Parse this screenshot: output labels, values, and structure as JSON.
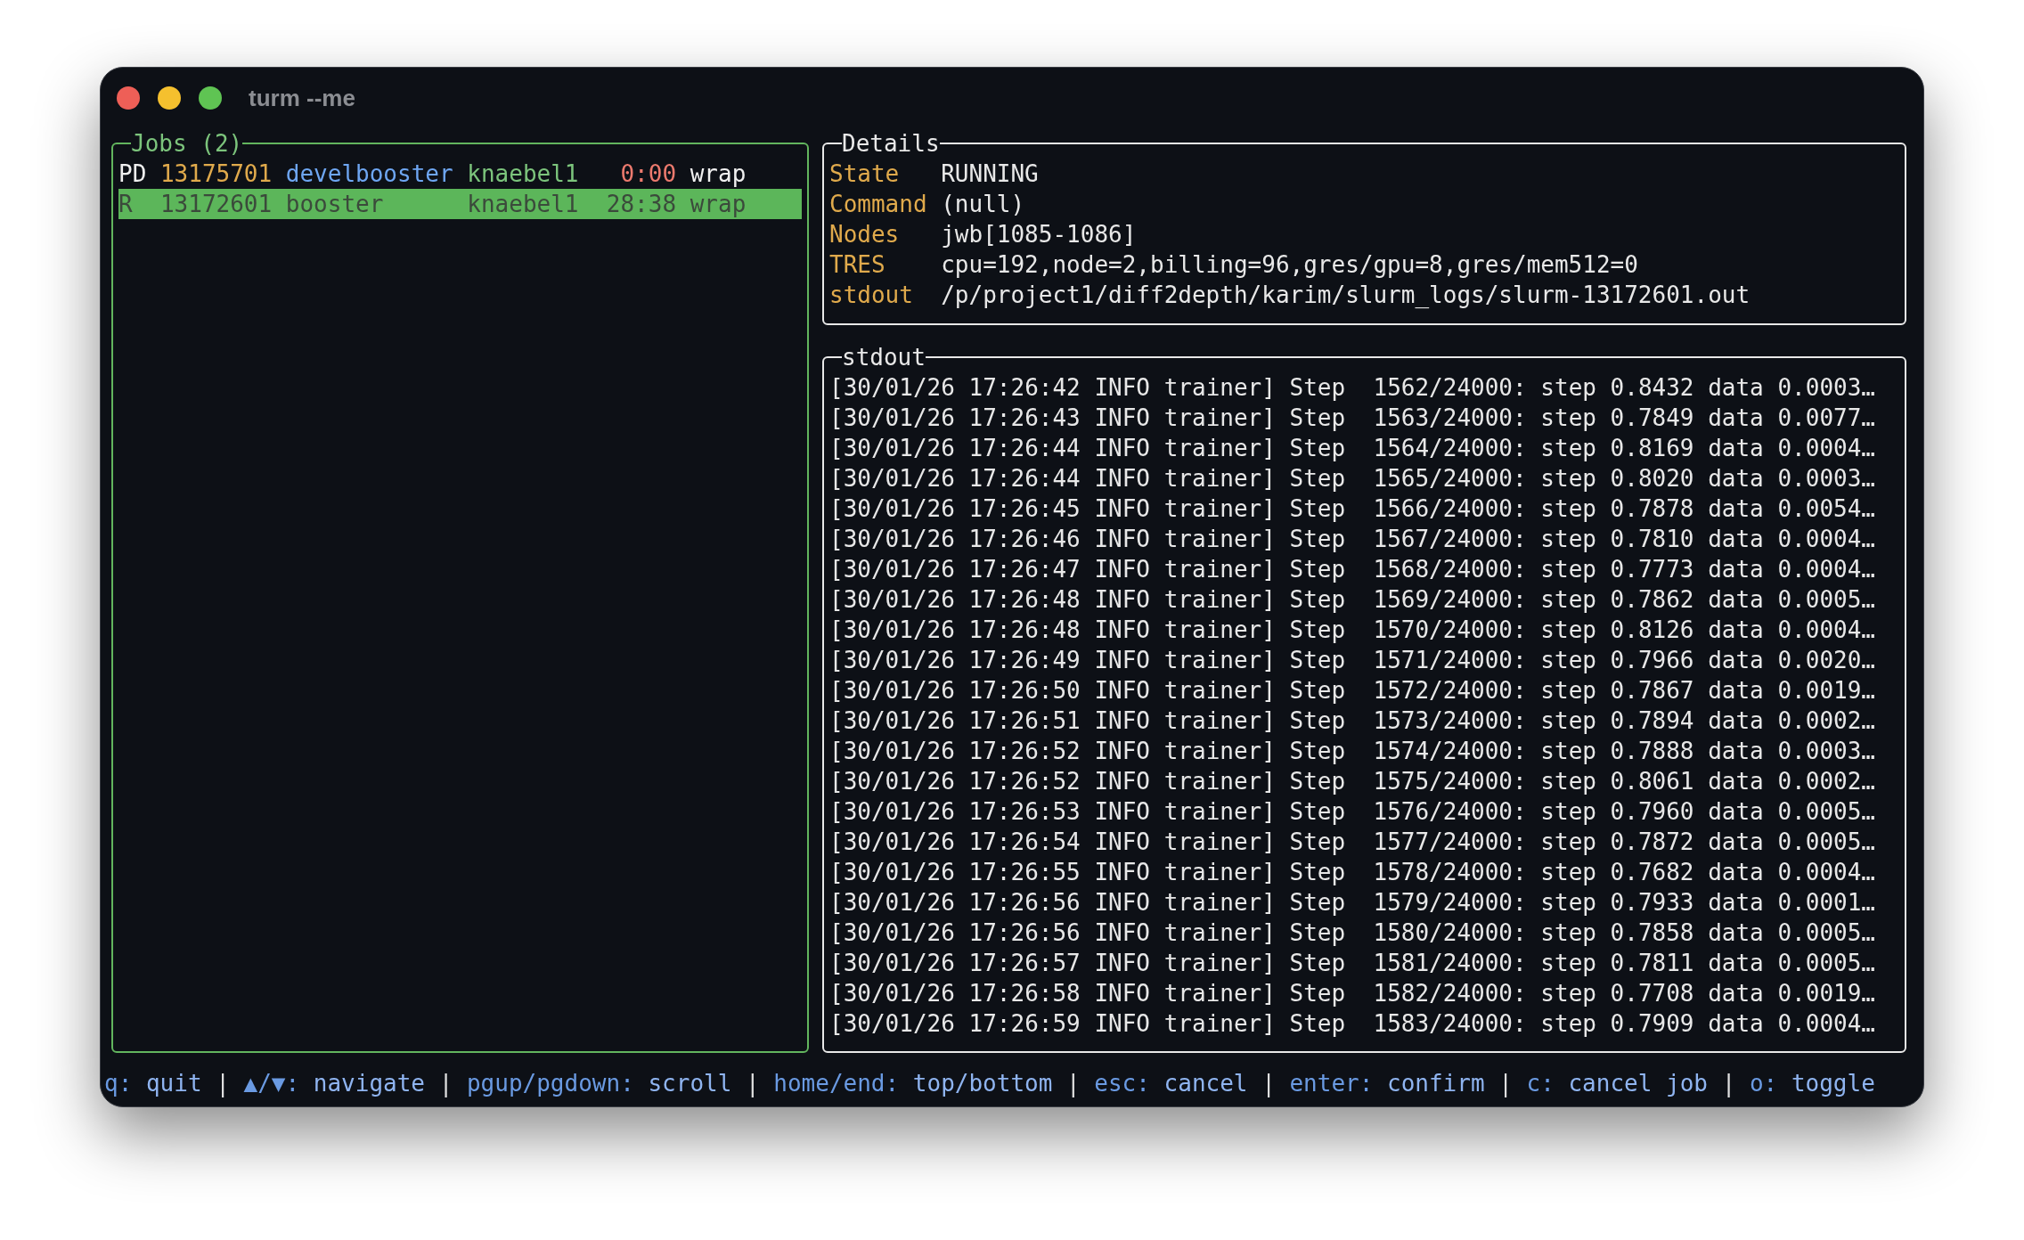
{
  "window": {
    "title": "turm --me"
  },
  "jobs": {
    "title": "Jobs (2)",
    "rows": [
      {
        "state": "PD",
        "id": "13175701",
        "name": "develbooster",
        "user": "knaebel1",
        "time": "0:00",
        "partition": "wrap",
        "selected": false
      },
      {
        "state": "R",
        "id": "13172601",
        "name": "booster",
        "user": "knaebel1",
        "time": "28:38",
        "partition": "wrap",
        "selected": true
      }
    ]
  },
  "details": {
    "title": "Details",
    "fields": [
      {
        "label": "State",
        "value": "RUNNING"
      },
      {
        "label": "Command",
        "value": "(null)"
      },
      {
        "label": "Nodes",
        "value": "jwb[1085-1086]"
      },
      {
        "label": "TRES",
        "value": "cpu=192,node=2,billing=96,gres/gpu=8,gres/mem512=0"
      },
      {
        "label": "stdout",
        "value": "/p/project1/diff2depth/karim/slurm_logs/slurm-13172601.out"
      }
    ]
  },
  "stdout": {
    "title": "stdout",
    "lines": [
      "[30/01/26 17:26:42 INFO trainer] Step  1562/24000: step 0.8432 data 0.0003…",
      "[30/01/26 17:26:43 INFO trainer] Step  1563/24000: step 0.7849 data 0.0077…",
      "[30/01/26 17:26:44 INFO trainer] Step  1564/24000: step 0.8169 data 0.0004…",
      "[30/01/26 17:26:44 INFO trainer] Step  1565/24000: step 0.8020 data 0.0003…",
      "[30/01/26 17:26:45 INFO trainer] Step  1566/24000: step 0.7878 data 0.0054…",
      "[30/01/26 17:26:46 INFO trainer] Step  1567/24000: step 0.7810 data 0.0004…",
      "[30/01/26 17:26:47 INFO trainer] Step  1568/24000: step 0.7773 data 0.0004…",
      "[30/01/26 17:26:48 INFO trainer] Step  1569/24000: step 0.7862 data 0.0005…",
      "[30/01/26 17:26:48 INFO trainer] Step  1570/24000: step 0.8126 data 0.0004…",
      "[30/01/26 17:26:49 INFO trainer] Step  1571/24000: step 0.7966 data 0.0020…",
      "[30/01/26 17:26:50 INFO trainer] Step  1572/24000: step 0.7867 data 0.0019…",
      "[30/01/26 17:26:51 INFO trainer] Step  1573/24000: step 0.7894 data 0.0002…",
      "[30/01/26 17:26:52 INFO trainer] Step  1574/24000: step 0.7888 data 0.0003…",
      "[30/01/26 17:26:52 INFO trainer] Step  1575/24000: step 0.8061 data 0.0002…",
      "[30/01/26 17:26:53 INFO trainer] Step  1576/24000: step 0.7960 data 0.0005…",
      "[30/01/26 17:26:54 INFO trainer] Step  1577/24000: step 0.7872 data 0.0005…",
      "[30/01/26 17:26:55 INFO trainer] Step  1578/24000: step 0.7682 data 0.0004…",
      "[30/01/26 17:26:56 INFO trainer] Step  1579/24000: step 0.7933 data 0.0001…",
      "[30/01/26 17:26:56 INFO trainer] Step  1580/24000: step 0.7858 data 0.0005…",
      "[30/01/26 17:26:57 INFO trainer] Step  1581/24000: step 0.7811 data 0.0005…",
      "[30/01/26 17:26:58 INFO trainer] Step  1582/24000: step 0.7708 data 0.0019…",
      "[30/01/26 17:26:59 INFO trainer] Step  1583/24000: step 0.7909 data 0.0004…"
    ]
  },
  "footer": {
    "separator": "|",
    "hints": [
      {
        "key": "q:",
        "action": "quit"
      },
      {
        "key": "▲/▼:",
        "action": "navigate"
      },
      {
        "key": "pgup/pgdown:",
        "action": "scroll"
      },
      {
        "key": "home/end:",
        "action": "top/bottom"
      },
      {
        "key": "esc:",
        "action": "cancel"
      },
      {
        "key": "enter:",
        "action": "confirm"
      },
      {
        "key": "c:",
        "action": "cancel job"
      },
      {
        "key": "o:",
        "action": "toggle"
      }
    ]
  }
}
